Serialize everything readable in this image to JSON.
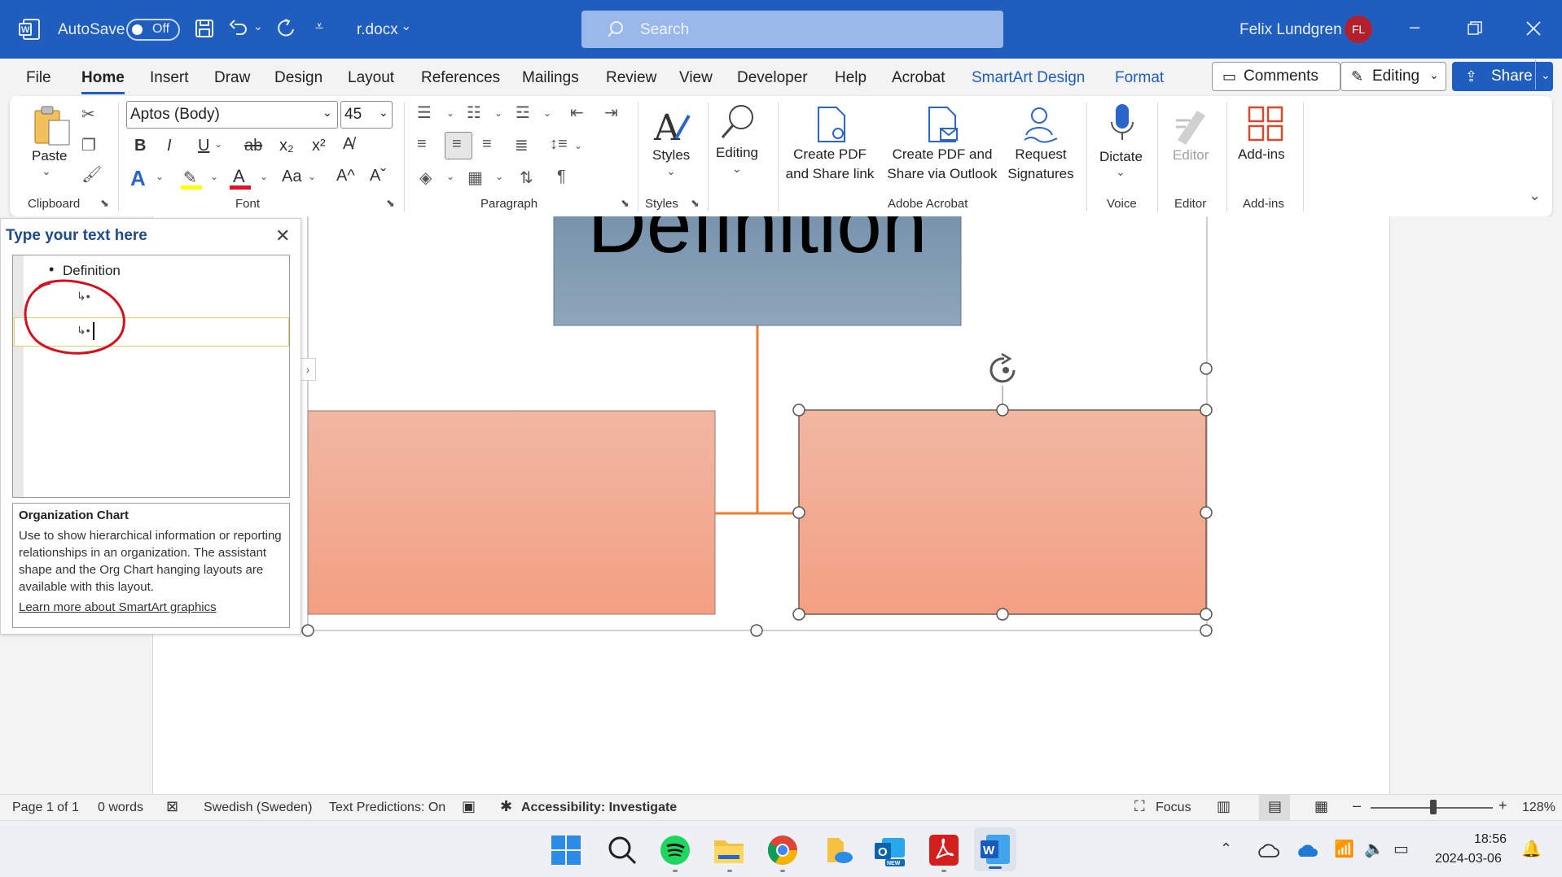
{
  "titlebar": {
    "app_icon": "word-icon",
    "autosave_label": "AutoSave",
    "autosave_state": "Off",
    "filename": "r.docx",
    "search_placeholder": "Search",
    "user_name": "Felix Lundgren",
    "user_initials": "FL"
  },
  "menu": {
    "tabs": [
      "File",
      "Home",
      "Insert",
      "Draw",
      "Design",
      "Layout",
      "References",
      "Mailings",
      "Review",
      "View",
      "Developer",
      "Help",
      "Acrobat",
      "SmartArt Design",
      "Format"
    ],
    "active_tab": "Home",
    "comments_label": "Comments",
    "editing_label": "Editing",
    "share_label": "Share"
  },
  "ribbon": {
    "clipboard": {
      "paste_label": "Paste",
      "group_label": "Clipboard"
    },
    "font": {
      "font_name": "Aptos (Body)",
      "font_size": "45",
      "group_label": "Font",
      "bold": "B",
      "italic": "I",
      "underline": "U",
      "strike": "ab",
      "subscript": "x₂",
      "superscript": "x²",
      "grow": "A^",
      "shrink": "Aˇ",
      "case": "Aa"
    },
    "paragraph": {
      "group_label": "Paragraph"
    },
    "styles": {
      "label": "Styles",
      "group_label": "Styles"
    },
    "editing": {
      "label": "Editing"
    },
    "acrobat": {
      "create_pdf_share_line1": "Create PDF",
      "create_pdf_share_line2": "and Share link",
      "create_pdf_outlook_line1": "Create PDF and",
      "create_pdf_outlook_line2": "Share via Outlook",
      "request_sig_line1": "Request",
      "request_sig_line2": "Signatures",
      "group_label": "Adobe Acrobat"
    },
    "voice": {
      "dictate_label": "Dictate",
      "group_label": "Voice"
    },
    "editor": {
      "label": "Editor",
      "group_label": "Editor"
    },
    "addins": {
      "label": "Add-ins",
      "group_label": "Add-ins"
    }
  },
  "text_pane": {
    "title": "Type your text here",
    "items": [
      "Definition",
      "",
      ""
    ],
    "description_title": "Organization Chart",
    "description_body": "Use to show hierarchical information or reporting relationships in an organization. The assistant shape and the Org Chart hanging layouts are available with this layout.",
    "learn_more": "Learn more about SmartArt graphics"
  },
  "smartart": {
    "top_box_text": "Definition",
    "colors": {
      "top_fill": "#8da5b9",
      "child_fill_top": "#f1b7a2",
      "child_fill_bottom": "#f3a083",
      "connector": "#ed7d31",
      "annotation": "#d4101d"
    }
  },
  "statusbar": {
    "page": "Page 1 of 1",
    "words": "0 words",
    "language": "Swedish (Sweden)",
    "predictions": "Text Predictions: On",
    "accessibility": "Accessibility: Investigate",
    "focus": "Focus",
    "zoom": "128%"
  },
  "taskbar": {
    "time": "18:56",
    "date": "2024-03-06",
    "apps": [
      "start-icon",
      "search-icon",
      "spotify-icon",
      "file-explorer-icon",
      "chrome-icon",
      "onedrive-photos-icon",
      "outlook-new-icon",
      "acrobat-icon",
      "word-icon"
    ]
  }
}
